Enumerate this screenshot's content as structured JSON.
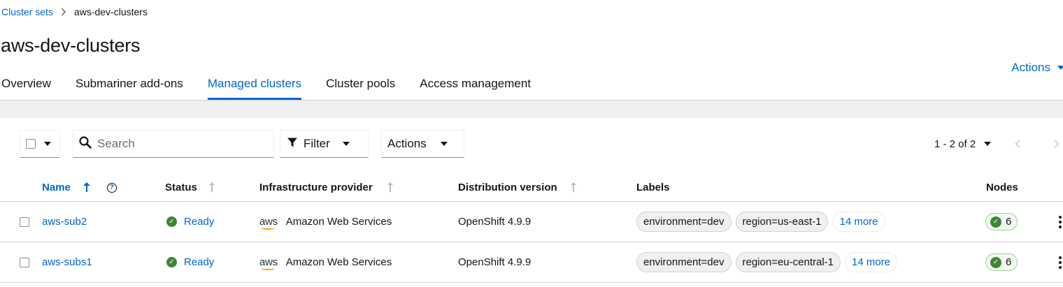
{
  "breadcrumb": {
    "parent": "Cluster sets",
    "current": "aws-dev-clusters"
  },
  "page_title": "aws-dev-clusters",
  "header_actions": "Actions",
  "tabs": [
    {
      "label": "Overview",
      "active": false
    },
    {
      "label": "Submariner add-ons",
      "active": false
    },
    {
      "label": "Managed clusters",
      "active": true
    },
    {
      "label": "Cluster pools",
      "active": false
    },
    {
      "label": "Access management",
      "active": false
    }
  ],
  "toolbar": {
    "search_placeholder": "Search",
    "filter_label": "Filter",
    "actions_label": "Actions",
    "pagination": "1 - 2 of 2"
  },
  "table": {
    "columns": [
      "Name",
      "Status",
      "Infrastructure provider",
      "Distribution version",
      "Labels",
      "Nodes"
    ],
    "rows": [
      {
        "name": "aws-sub2",
        "status": "Ready",
        "provider_logo": "aws",
        "provider": "Amazon Web Services",
        "version": "OpenShift 4.9.9",
        "labels": [
          "environment=dev",
          "region=us-east-1"
        ],
        "more": "14 more",
        "nodes": "6"
      },
      {
        "name": "aws-subs1",
        "status": "Ready",
        "provider_logo": "aws",
        "provider": "Amazon Web Services",
        "version": "OpenShift 4.9.9",
        "labels": [
          "environment=dev",
          "region=eu-central-1"
        ],
        "more": "14 more",
        "nodes": "6"
      }
    ]
  },
  "colors": {
    "link": "#0066cc",
    "success": "#3e8635",
    "border": "#d2d2d2",
    "band": "#f0f0f0"
  },
  "icons": [
    "chevron-right-icon",
    "caret-down-icon",
    "search-icon",
    "filter-icon",
    "sort-icon",
    "help-icon",
    "check-circle-icon",
    "kebab-icon"
  ]
}
